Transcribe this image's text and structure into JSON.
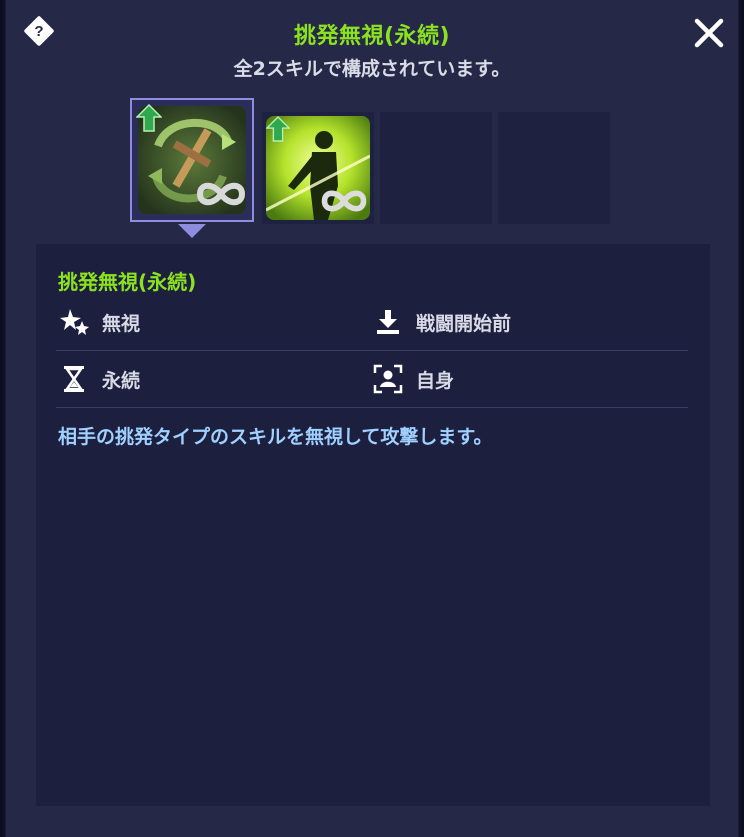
{
  "header": {
    "title": "挑発無視(永続)",
    "subtitle": "全2スキルで構成されています。"
  },
  "icons": {
    "help": "help-diamond-icon",
    "help_glyph": "?",
    "close": "close-icon",
    "upgrade": "upgrade-arrow-icon",
    "infinite": "infinity-icon"
  },
  "skills": [
    {
      "icon": "sword-swirl-skill-icon",
      "state": "selected"
    },
    {
      "icon": "figure-burst-skill-icon",
      "state": "normal"
    },
    {
      "state": "empty"
    },
    {
      "state": "empty"
    }
  ],
  "detail": {
    "name": "挑発無視(永続)",
    "attributes": [
      {
        "icon": "stars-icon",
        "label": "無視"
      },
      {
        "icon": "download-tray-icon",
        "label": "戦闘開始前"
      },
      {
        "icon": "hourglass-icon",
        "label": "永続"
      },
      {
        "icon": "self-target-icon",
        "label": "自身"
      }
    ],
    "description": "相手の挑発タイプのスキルを無視して攻撃します。"
  },
  "colors": {
    "accent_green": "#8be21f",
    "description_blue": "#9fd0ff",
    "panel_bg": "#252847",
    "detail_bg": "#1d1f3f",
    "selected_border": "#8e8cdc"
  }
}
